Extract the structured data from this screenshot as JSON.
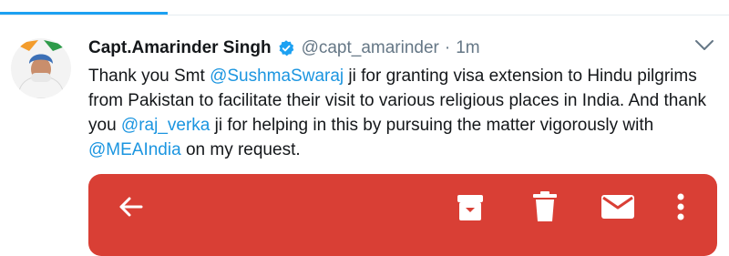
{
  "tweet": {
    "author_name": "Capt.Amarinder Singh",
    "handle": "@capt_amarinder",
    "separator": "·",
    "time": "1m",
    "text_parts": [
      "Thank you Smt ",
      "@SushmaSwaraj",
      " ji for granting visa extension to Hindu pilgrims from Pakistan to facilitate their visit to various religious places in India. And thank you ",
      "@raj_verka",
      " ji for helping in this by pursuing the matter vigorously with ",
      "@MEAIndia",
      " on my request."
    ]
  },
  "media_toolbar": {
    "background_color": "#d93f35",
    "icons": [
      "back-arrow-icon",
      "archive-icon",
      "delete-icon",
      "mail-icon",
      "more-vertical-icon"
    ]
  },
  "colors": {
    "accent": "#1da1f2",
    "mention": "#1b95e0",
    "verified": "#1da1f2"
  }
}
